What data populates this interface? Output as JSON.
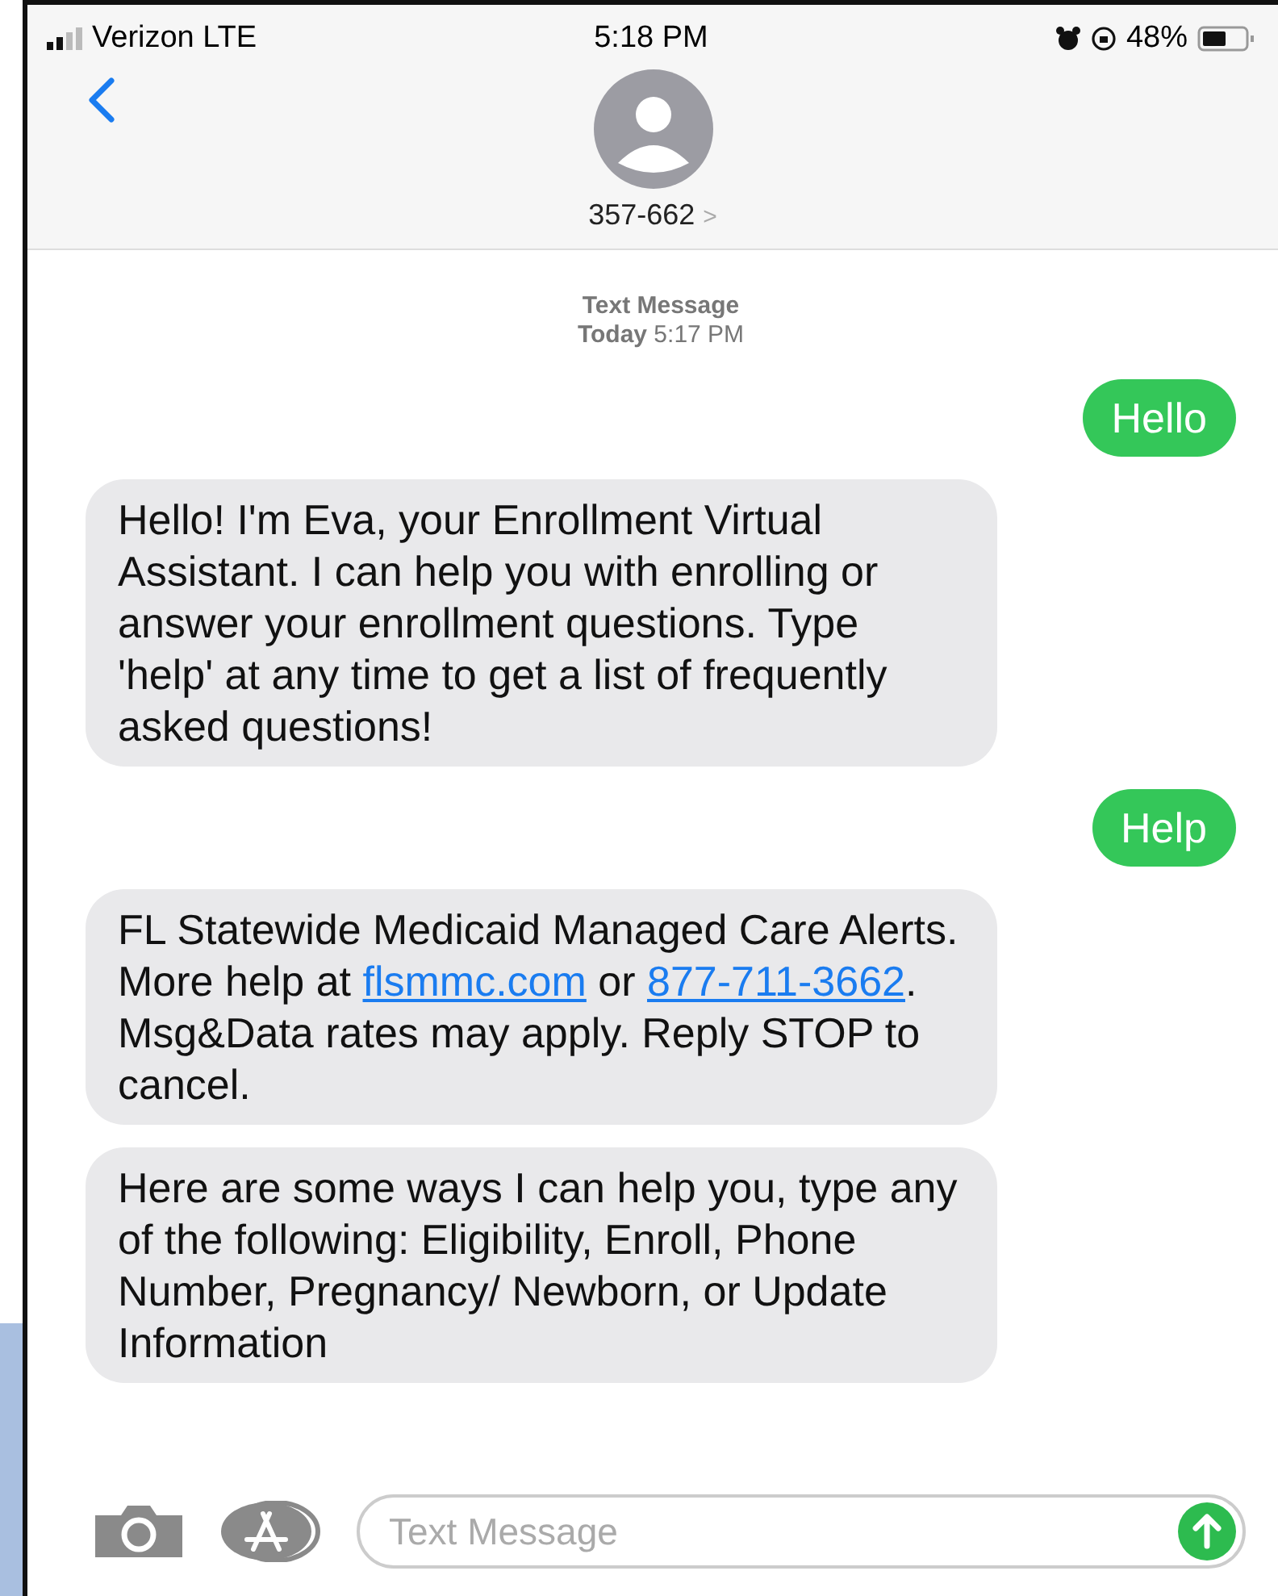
{
  "status_bar": {
    "carrier": "Verizon LTE",
    "time": "5:18 PM",
    "battery": "48%"
  },
  "header": {
    "contact": "357-662",
    "chevron": ">"
  },
  "thread_info": {
    "label": "Text Message",
    "timestamp": "**Today** 5:17 PM"
  },
  "messages": [
    {
      "kind": "sent",
      "parts": [
        {
          "kind": "text",
          "text": "Hello"
        }
      ]
    },
    {
      "kind": "received",
      "parts": [
        {
          "kind": "text",
          "text": "Hello! I'm Eva, your Enrollment Virtual Assistant. I can help you with enrolling or answer your enrollment questions. Type 'help' at any time to get a list of frequently asked questions!"
        }
      ]
    },
    {
      "kind": "sent",
      "parts": [
        {
          "kind": "text",
          "text": "Help"
        }
      ]
    },
    {
      "kind": "received",
      "parts": [
        {
          "kind": "text",
          "text": "FL Statewide Medicaid Managed Care Alerts. More help at "
        },
        {
          "kind": "link",
          "text": "flsmmc.com"
        },
        {
          "kind": "text",
          "text": " or "
        },
        {
          "kind": "link",
          "text": "877-711-3662"
        },
        {
          "kind": "text",
          "text": ". Msg&Data rates may apply. Reply STOP to cancel."
        }
      ]
    },
    {
      "kind": "received",
      "parts": [
        {
          "kind": "text",
          "text": "Here are some ways I can help you, type any of the following: Eligibility, Enroll, Phone Number, Pregnancy/ Newborn, or Update Information"
        }
      ]
    }
  ],
  "composer": {
    "placeholder": "Text Message"
  }
}
